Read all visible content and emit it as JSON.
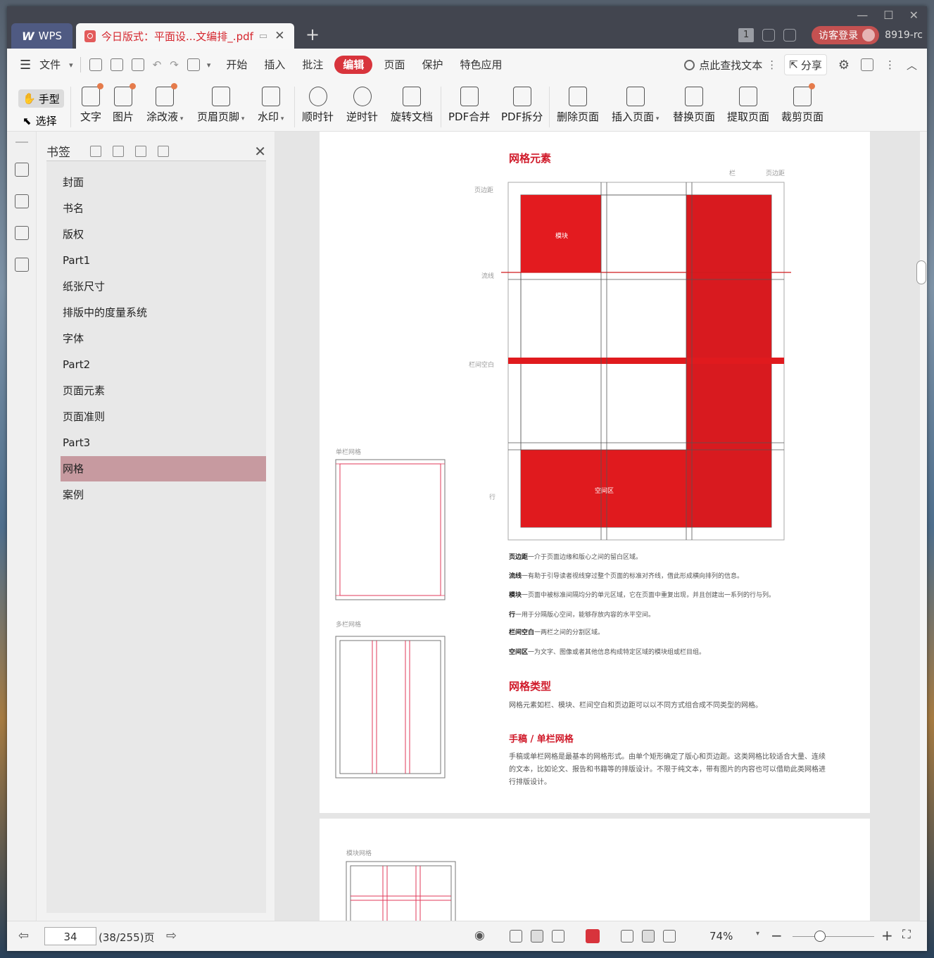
{
  "titlebar": {
    "app_label": "WPS",
    "doc_tab_title": "今日版式：平面设...文编排_.pdf",
    "page_count_badge": "1",
    "login_label": "访客登录",
    "user_label": "8919-rc"
  },
  "menu": {
    "file_label": "文件",
    "items": [
      "开始",
      "插入",
      "批注",
      "编辑",
      "页面",
      "保护",
      "特色应用"
    ],
    "active": "编辑",
    "search_label": "点此查找文本",
    "share_label": "分享"
  },
  "toolbar": {
    "hand_label": "手型",
    "select_label": "选择",
    "tools": [
      "文字",
      "图片",
      "涂改液",
      "页眉页脚",
      "水印",
      "顺时针",
      "逆时针",
      "旋转文档",
      "PDF合并",
      "PDF拆分",
      "删除页面",
      "插入页面",
      "替换页面",
      "提取页面",
      "裁剪页面"
    ]
  },
  "bookmarks": {
    "title": "书签",
    "items": [
      "封面",
      "书名",
      "版权",
      "Part1",
      "纸张尺寸",
      "排版中的度量系统",
      "字体",
      "Part2",
      "页面元素",
      "页面准则",
      "Part3",
      "网格",
      "案例"
    ],
    "selected": "网格"
  },
  "page": {
    "heading1": "网格元素",
    "label_col": "栏",
    "label_margin_top": "页边距",
    "label_margin_left": "页边距",
    "label_flowline": "流线",
    "label_gutter": "栏间空白",
    "label_row": "行",
    "label_module": "模块",
    "label_spatial": "空间区",
    "label_single": "单栏网格",
    "label_multi": "多栏网格",
    "defs": [
      {
        "term": "页边距",
        "desc": "一介于页面边缘和版心之间的留白区域。"
      },
      {
        "term": "流线",
        "desc": "一有助于引导读者视线穿过整个页面的标准对齐线，借此形成横向排列的信息。"
      },
      {
        "term": "模块",
        "desc": "一页面中被标准间隔均分的单元区域，它在页面中重复出现，并且创建出一系列的行与列。"
      },
      {
        "term": "行",
        "desc": "一用于分隔版心空间，能够存放内容的水平空间。"
      },
      {
        "term": "栏间空白",
        "desc": "一两栏之间的分割区域。"
      },
      {
        "term": "空间区",
        "desc": "一为文字、图像或者其他信息构成特定区域的模块组或栏目组。"
      }
    ],
    "heading2": "网格类型",
    "para1": "网格元素如栏、模块、栏间空白和页边距可以以不同方式组合成不同类型的网格。",
    "heading3": "手稿 / 单栏网格",
    "para2_line1": "手稿或单栏网格是最基本的网格形式。由单个矩形确定了版心和页边距。这类网格比较适合大量、连续",
    "para2_line2": "的文本，比如论文、报告和书籍等的排版设计。不限于纯文本，带有图片的内容也可以借助此类网格进",
    "para2_line3": "行排版设计。",
    "page2_label": "模块网格"
  },
  "status": {
    "page_input": "34",
    "page_total": "(38/255)页",
    "zoom": "74%"
  },
  "colors": {
    "accent": "#d8343c",
    "grid_red": "#d01a1f",
    "bookmark_sel": "#c79aa0"
  }
}
